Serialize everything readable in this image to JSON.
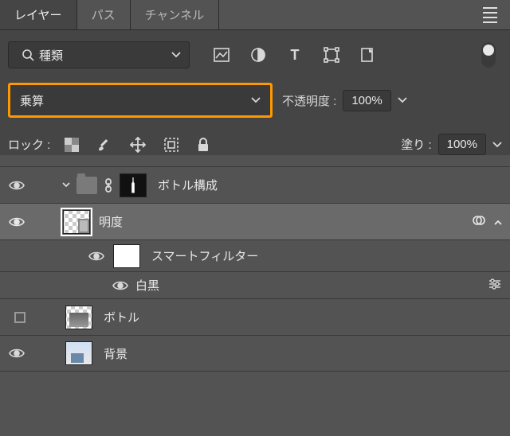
{
  "tabs": {
    "layers": "レイヤー",
    "paths": "パス",
    "channels": "チャンネル"
  },
  "filter": {
    "label": "種類"
  },
  "blend": {
    "mode": "乗算"
  },
  "opacity": {
    "label": "不透明度 :",
    "value": "100%"
  },
  "lock": {
    "label": "ロック :"
  },
  "fill": {
    "label": "塗り :",
    "value": "100%"
  },
  "layers": {
    "group": "ボトル構成",
    "brightness": "明度",
    "smartfilter": "スマートフィルター",
    "bw": "白黒",
    "bottle": "ボトル",
    "background": "背景"
  }
}
